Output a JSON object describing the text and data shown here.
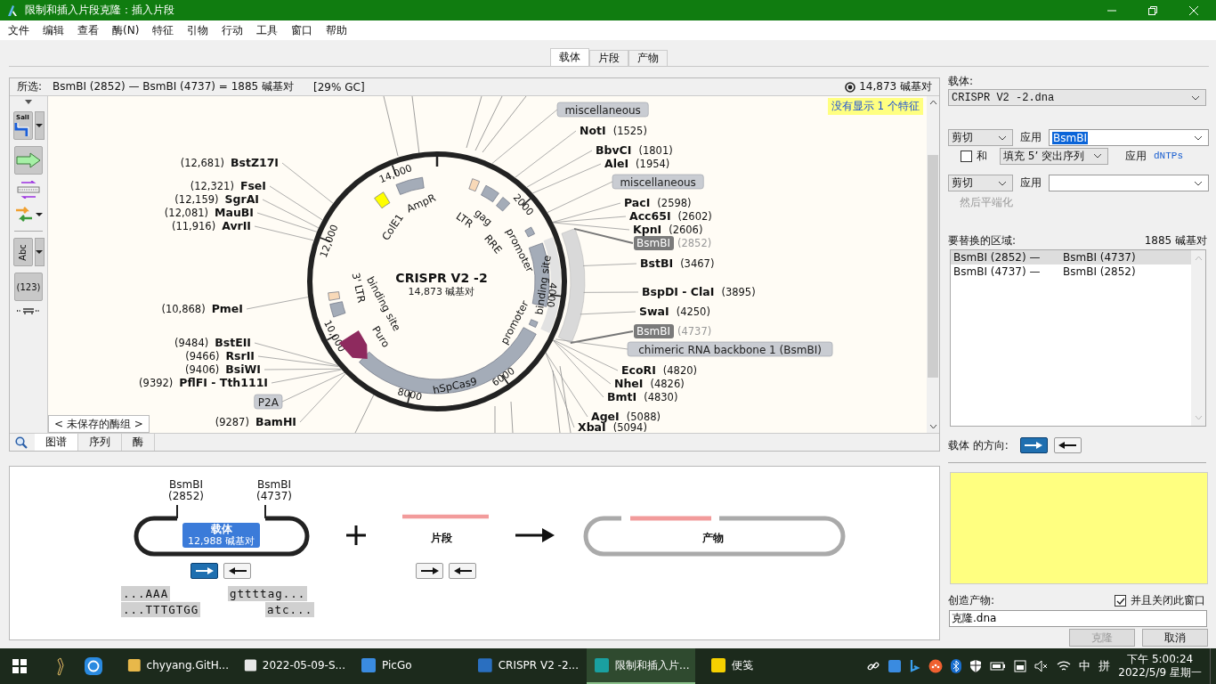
{
  "window": {
    "title": "限制和插入片段克隆：插入片段"
  },
  "menu": [
    "文件",
    "编辑",
    "查看",
    "酶(N)",
    "特征",
    "引物",
    "行动",
    "工具",
    "窗口",
    "帮助"
  ],
  "tabs": [
    {
      "label": "载体",
      "selected": true
    },
    {
      "label": "片段",
      "selected": false
    },
    {
      "label": "产物",
      "selected": false
    }
  ],
  "map_panel": {
    "selection_label": "所选:",
    "selection": "BsmBI (2852) — BsmBI (4737) = 1885 碱基对",
    "gc": "[29% GC]",
    "total_length": "14,873 碱基对",
    "hidden_notice": "没有显示 1 个特征",
    "toolbar": {
      "enzyme_icon_label": "SalI",
      "text_button": "Abc",
      "number_button": "(123)"
    },
    "map": {
      "name": "CRISPR V2 -2",
      "length": "14,873 碱基对",
      "ticks": [
        "2000",
        "4000",
        "6000",
        "8000",
        "10,000",
        "12,000",
        "14,000"
      ],
      "features": [
        "AmpR",
        "ColE1",
        "LTR",
        "gag",
        "RRE",
        "promoter",
        "binding site",
        "promoter",
        "hSpCas9",
        "Puro",
        "binding site",
        "3' LTR"
      ],
      "labels": [
        {
          "kind": "enzyme",
          "name": "BstZ17I",
          "position": "(12,681)",
          "selected": false
        },
        {
          "kind": "enzyme",
          "name": "FseI",
          "position": "(12,321)",
          "selected": false
        },
        {
          "kind": "enzyme",
          "name": "SgrAI",
          "position": "(12,159)",
          "selected": false
        },
        {
          "kind": "enzyme",
          "name": "MauBI",
          "position": "(12,081)",
          "selected": false
        },
        {
          "kind": "enzyme",
          "name": "AvrII",
          "position": "(11,916)",
          "selected": false
        },
        {
          "kind": "enzyme",
          "name": "PmeI",
          "position": "(10,868)",
          "selected": false
        },
        {
          "kind": "enzyme",
          "name": "BstEII",
          "position": "(9484)",
          "selected": false
        },
        {
          "kind": "enzyme",
          "name": "RsrII",
          "position": "(9466)",
          "selected": false
        },
        {
          "kind": "enzyme",
          "name": "BsiWI",
          "position": "(9406)",
          "selected": false
        },
        {
          "kind": "enzyme",
          "name": "PflFI - Tth111I",
          "position": "(9392)",
          "selected": false
        },
        {
          "kind": "feature",
          "name": "P2A"
        },
        {
          "kind": "enzyme",
          "name": "BamHI",
          "position": "(9287)",
          "selected": false
        },
        {
          "kind": "feature",
          "name": "miscellaneous"
        },
        {
          "kind": "enzyme",
          "name": "NotI",
          "position": "(1525)",
          "selected": false
        },
        {
          "kind": "enzyme",
          "name": "BbvCI",
          "position": "(1801)",
          "selected": false
        },
        {
          "kind": "enzyme",
          "name": "AleI",
          "position": "(1954)",
          "selected": false
        },
        {
          "kind": "feature",
          "name": "miscellaneous"
        },
        {
          "kind": "enzyme",
          "name": "PacI",
          "position": "(2598)",
          "selected": false
        },
        {
          "kind": "enzyme",
          "name": "Acc65I",
          "position": "(2602)",
          "selected": false
        },
        {
          "kind": "enzyme",
          "name": "KpnI",
          "position": "(2606)",
          "selected": false
        },
        {
          "kind": "enzyme",
          "name": "BsmBI",
          "position": "(2852)",
          "selected": true
        },
        {
          "kind": "enzyme",
          "name": "BstBI",
          "position": "(3467)",
          "selected": false
        },
        {
          "kind": "enzyme",
          "name": "BspDI - ClaI",
          "position": "(3895)",
          "selected": false
        },
        {
          "kind": "enzyme",
          "name": "SwaI",
          "position": "(4250)",
          "selected": false
        },
        {
          "kind": "enzyme",
          "name": "BsmBI",
          "position": "(4737)",
          "selected": true
        },
        {
          "kind": "feature",
          "name": "chimeric RNA backbone 1 (BsmBI)"
        },
        {
          "kind": "enzyme",
          "name": "EcoRI",
          "position": "(4820)",
          "selected": false
        },
        {
          "kind": "enzyme",
          "name": "NheI",
          "position": "(4826)",
          "selected": false
        },
        {
          "kind": "enzyme",
          "name": "BmtI",
          "position": "(4830)",
          "selected": false
        },
        {
          "kind": "enzyme",
          "name": "AgeI",
          "position": "(5088)",
          "selected": false
        },
        {
          "kind": "enzyme",
          "name": "XbaI",
          "position": "(5094)",
          "selected": false
        }
      ]
    },
    "enzyme_set_button": "< 未保存的酶组 >",
    "view_tabs": [
      {
        "label": "图谱",
        "selected": true
      },
      {
        "label": "序列",
        "selected": false
      },
      {
        "label": "酶",
        "selected": false
      }
    ]
  },
  "right_panel": {
    "vector_label": "载体:",
    "vector_file": "CRISPR V2 -2.dna",
    "cut_rows": [
      {
        "action": "剪切",
        "apply_label": "应用",
        "enzyme": "BsmBI"
      },
      {
        "action": "剪切",
        "apply_label": "应用"
      }
    ],
    "fill_row": {
      "checkbox_label": "和",
      "checked": false,
      "option": "填充 5’ 突出序列",
      "apply_label": "应用",
      "link": "dNTPs"
    },
    "blunt_label": "然后平端化",
    "blunt_disabled": true,
    "regions_label": "要替换的区域:",
    "regions_length": "1885 碱基对",
    "regions": [
      {
        "from": "BsmBI (2852) —",
        "to": "BsmBI (4737)",
        "selected": true
      },
      {
        "from": "BsmBI (4737) —",
        "to": "BsmBI (2852)",
        "selected": false
      }
    ],
    "orientation_label": "载体 的方向:",
    "orientation": [
      {
        "kind": "forward",
        "selected": true
      },
      {
        "kind": "reverse",
        "selected": false
      }
    ]
  },
  "diagram": {
    "cut_sites": [
      {
        "name": "BsmBI",
        "position": "(2852)"
      },
      {
        "name": "BsmBI",
        "position": "(4737)"
      }
    ],
    "vector": {
      "label": "载体",
      "length": "12,988 碱基对",
      "orientation": [
        {
          "kind": "forward",
          "selected": true
        },
        {
          "kind": "reverse",
          "selected": false
        }
      ]
    },
    "sequences": [
      "...AAA",
      "...TTTGTGG",
      "gttttag...",
      "atc..."
    ],
    "fragment": {
      "label": "片段",
      "orientation": [
        {
          "kind": "forward",
          "selected": false
        },
        {
          "kind": "reverse",
          "selected": false
        }
      ]
    },
    "product": {
      "label": "产物"
    }
  },
  "product_panel": {
    "create_label": "创造产物:",
    "close_checkbox": {
      "label": "并且关闭此窗口",
      "checked": true
    },
    "filename": "克隆.dna",
    "buttons": [
      {
        "label": "克隆",
        "disabled": true
      },
      {
        "label": "取消",
        "disabled": false
      }
    ]
  },
  "taskbar": {
    "apps": [
      {
        "label": "chyyang.GitH...",
        "active": false
      },
      {
        "label": "2022-05-09-S...",
        "active": false
      },
      {
        "label": "PicGo",
        "active": false
      },
      {
        "label": "CRISPR V2 -2...",
        "active": false
      },
      {
        "label": "限制和插入片...",
        "active": true
      },
      {
        "label": "便笺",
        "active": false
      }
    ],
    "ime": "中",
    "ime_mode": "拼",
    "time": "下午 5:00:24",
    "date": "2022/5/9 星期一"
  }
}
